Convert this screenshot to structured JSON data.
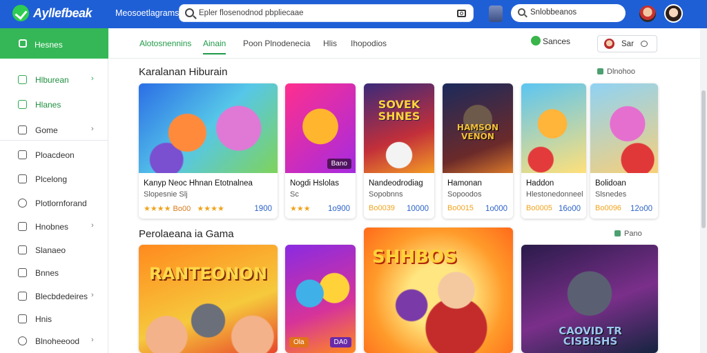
{
  "app": {
    "brand": "Ayllefbeak",
    "nav_label": "Meosoetlagrams"
  },
  "search": {
    "placeholder": "Epler flosenodnod pbpliecaae",
    "secondary_placeholder": "Snlobbeanos"
  },
  "sidebar": {
    "home": "Hesnes",
    "items": [
      {
        "label": "Hlburean",
        "icon": "chart-icon",
        "has_chevron": true
      },
      {
        "label": "Hlanes",
        "icon": "bookmark-icon",
        "has_chevron": false
      },
      {
        "label": "Gome",
        "icon": "gamepad-icon",
        "has_chevron": true
      },
      {
        "label": "Ploacdeon",
        "icon": "tag-icon",
        "has_chevron": false
      },
      {
        "label": "Plcelong",
        "icon": "document-icon",
        "has_chevron": false
      },
      {
        "label": "Plotlornforand",
        "icon": "clock-icon",
        "has_chevron": false
      },
      {
        "label": "Hnobnes",
        "icon": "folder-icon",
        "has_chevron": true
      },
      {
        "label": "Slanaeo",
        "icon": "box-icon",
        "has_chevron": false
      },
      {
        "label": "Bnnes",
        "icon": "bag-icon",
        "has_chevron": false
      },
      {
        "label": "Blecbdedeires",
        "icon": "star-icon",
        "has_chevron": true
      },
      {
        "label": "Hnis",
        "icon": "heart-icon",
        "has_chevron": false
      },
      {
        "label": "Blnoheeood",
        "icon": "settings-icon",
        "has_chevron": true
      }
    ]
  },
  "tabs": [
    {
      "label": "Alotosnennins"
    },
    {
      "label": "Ainain"
    },
    {
      "label": "Poon Plnodenecia"
    },
    {
      "label": "Hlis"
    },
    {
      "label": "Ihopodios"
    }
  ],
  "toolbar": {
    "filter_label": "Sances",
    "account_label": "Sar"
  },
  "sections": [
    {
      "title": "Karalanan Hiburain",
      "link": "Dlnohoo",
      "cards": [
        {
          "name": "Kanyp Neoc Hhnan Etotnalnea",
          "subtitle": "Slopesnie Slj",
          "stars": "★★★★",
          "stars2": "★★★★",
          "price": "1900",
          "price2": "Bo00",
          "badge": ""
        },
        {
          "name": "Nogdi Hslolas",
          "subtitle": "Sc",
          "stars": "★★★",
          "stars2": "",
          "price": "1o900",
          "price2": "",
          "badge": "Bano"
        },
        {
          "name": "Nandeodrodiag",
          "subtitle": "Sopobnns",
          "stars": "",
          "stars2": "Bo0039",
          "price": "10000",
          "price2": "",
          "badge": ""
        },
        {
          "name": "Hamonan",
          "subtitle": "Sopoodos",
          "stars": "",
          "stars2": "Bo0015",
          "price": "1o000",
          "price2": "",
          "badge": ""
        },
        {
          "name": "Haddon",
          "subtitle": "Hlestonedonneel",
          "stars": "",
          "stars2": "Bo0005",
          "price": "16o00",
          "price2": "",
          "badge": ""
        },
        {
          "name": "Bolidoan",
          "subtitle": "Slsnedes",
          "stars": "",
          "stars2": "Bo0096",
          "price": "12o00",
          "price2": "",
          "badge": ""
        }
      ]
    },
    {
      "title": "Perolaeana ia Gama",
      "link": "Pano",
      "cards": [
        {
          "art_text": "RANTEONON",
          "badge1": "",
          "badge2": ""
        },
        {
          "art_text": "",
          "badge1": "Ola",
          "badge2": "DA0"
        },
        {
          "art_text": "SHHBOS",
          "badge1": "",
          "badge2": ""
        },
        {
          "art_text": "CAOVID TR CISBISHS",
          "badge1": "",
          "badge2": ""
        }
      ]
    }
  ],
  "art_titles": {
    "card3": "SOVEK SHNES",
    "card4": "HAMSON VENON"
  },
  "colors": {
    "topbar": "#1f5fd6",
    "accent_green": "#35b757",
    "price_blue": "#2d63c8",
    "star": "#f0a31c"
  }
}
